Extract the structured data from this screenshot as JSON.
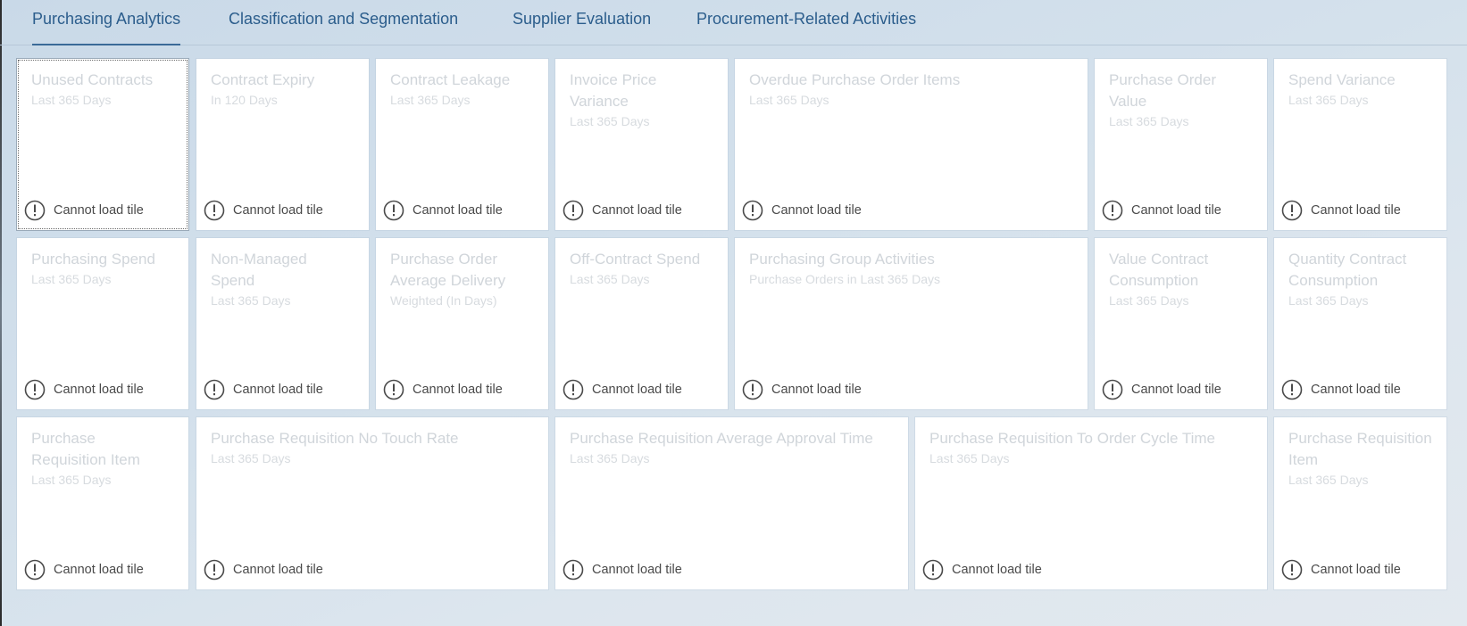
{
  "tabs": [
    {
      "label": "Purchasing Analytics",
      "active": true
    },
    {
      "label": "Classification and Segmentation",
      "active": false
    },
    {
      "label": "Supplier Evaluation",
      "active": false
    },
    {
      "label": "Procurement-Related Activities",
      "active": false
    }
  ],
  "error_text": "Cannot load tile",
  "tiles": [
    {
      "title": "Unused Contracts",
      "subtitle": "Last 365 Days"
    },
    {
      "title": "Contract Expiry",
      "subtitle": "In 120 Days"
    },
    {
      "title": "Contract Leakage",
      "subtitle": "Last 365 Days"
    },
    {
      "title": "Invoice Price Variance",
      "subtitle": "Last 365 Days"
    },
    {
      "title": "Overdue Purchase Order Items",
      "subtitle": "Last 365 Days"
    },
    {
      "title": "Purchase Order Value",
      "subtitle": "Last 365 Days"
    },
    {
      "title": "Spend Variance",
      "subtitle": "Last 365 Days"
    },
    {
      "title": "Purchasing Spend",
      "subtitle": "Last 365 Days"
    },
    {
      "title": "Non-Managed Spend",
      "subtitle": "Last 365 Days"
    },
    {
      "title": "Purchase Order Average Delivery",
      "subtitle": "Weighted (In Days)"
    },
    {
      "title": "Off-Contract Spend",
      "subtitle": "Last 365 Days"
    },
    {
      "title": "Purchasing Group Activities",
      "subtitle": "Purchase Orders in Last 365 Days"
    },
    {
      "title": "Value Contract Consumption",
      "subtitle": "Last 365 Days"
    },
    {
      "title": "Quantity Contract Consumption",
      "subtitle": "Last 365 Days"
    },
    {
      "title": "Purchase Requisition Item",
      "subtitle": "Last 365 Days"
    },
    {
      "title": "Purchase Requisition No Touch Rate",
      "subtitle": "Last 365 Days"
    },
    {
      "title": "Purchase Requisition Average Approval Time",
      "subtitle": "Last 365 Days"
    },
    {
      "title": "Purchase Requisition To Order Cycle Time",
      "subtitle": "Last 365 Days"
    },
    {
      "title": "Purchase Requisition Item",
      "subtitle": "Last 365 Days"
    }
  ],
  "icons": {
    "error": "exclamation-circle-icon"
  }
}
